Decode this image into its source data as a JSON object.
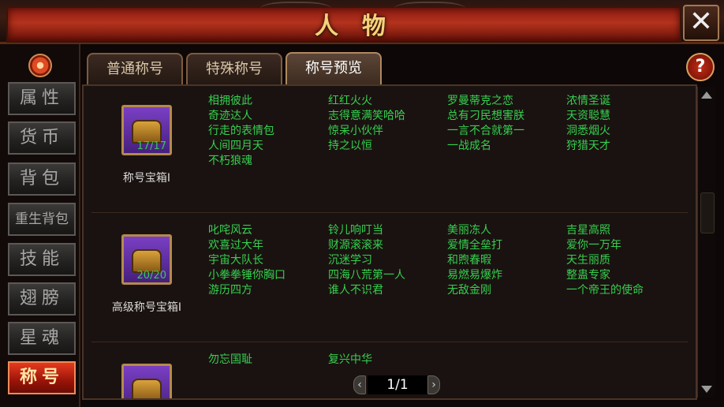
{
  "header": {
    "title": "人物",
    "close_glyph": "✕"
  },
  "sidebar": {
    "settings_icon": "settings-icon",
    "items": [
      {
        "label": "属性",
        "active": false
      },
      {
        "label": "货币",
        "active": false
      },
      {
        "label": "背包",
        "active": false
      },
      {
        "label": "重生背包",
        "active": false
      },
      {
        "label": "技能",
        "active": false
      },
      {
        "label": "翅膀",
        "active": false
      },
      {
        "label": "星魂",
        "active": false
      },
      {
        "label": "称号",
        "active": true
      }
    ]
  },
  "tabs": [
    {
      "label": "普通称号",
      "active": false
    },
    {
      "label": "特殊称号",
      "active": false
    },
    {
      "label": "称号预览",
      "active": true
    }
  ],
  "help_glyph": "?",
  "rows": [
    {
      "chest_name": "称号宝箱I",
      "chest_count": "17/17",
      "columns": [
        [
          "相拥彼此",
          "奇迹达人",
          "行走的表情包",
          "人间四月天",
          "不朽狼魂"
        ],
        [
          "红红火火",
          "志得意满笑哈哈",
          "惊呆小伙伴",
          "持之以恒"
        ],
        [
          "罗曼蒂克之恋",
          "总有刁民想害朕",
          "一言不合就第一",
          "一战成名"
        ],
        [
          "浓情圣诞",
          "天资聪慧",
          "洞悉烟火",
          "狩猎天才"
        ]
      ]
    },
    {
      "chest_name": "高级称号宝箱I",
      "chest_count": "20/20",
      "columns": [
        [
          "叱咤风云",
          "欢喜过大年",
          "宇宙大队长",
          "小拳拳锤你胸口",
          "游历四方"
        ],
        [
          "铃儿响叮当",
          "财源滚滚来",
          "沉迷学习",
          "四海八荒第一人",
          "谁人不识君"
        ],
        [
          "美丽冻人",
          "爱情全垒打",
          "和煦春暇",
          "易燃易爆炸",
          "无敌金刚"
        ],
        [
          "吉星高照",
          "爱你一万年",
          "天生丽质",
          "整蛊专家",
          "一个帝王的使命"
        ]
      ]
    },
    {
      "chest_name": "",
      "chest_count": "",
      "columns": [
        [
          "勿忘国耻"
        ],
        [
          "复兴中华"
        ],
        [],
        []
      ]
    }
  ],
  "pager": {
    "label": "1/1",
    "prev": "‹",
    "next": "›"
  },
  "colors": {
    "accent": "#35d04f",
    "active_tab": "#b3321d"
  }
}
